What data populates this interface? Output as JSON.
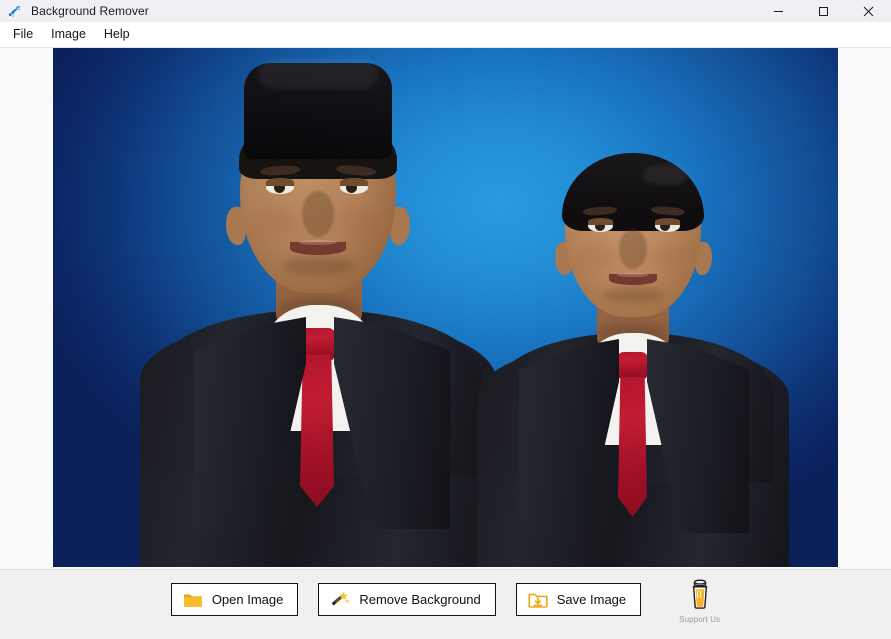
{
  "window": {
    "title": "Background Remover",
    "icon": "app-brush-icon",
    "controls": {
      "minimize": "minimize-icon",
      "maximize": "maximize-icon",
      "close": "close-icon"
    }
  },
  "menu": {
    "items": [
      {
        "label": "File"
      },
      {
        "label": "Image"
      },
      {
        "label": "Help"
      }
    ]
  },
  "canvas": {
    "image_description": "Studio portrait of two men in dark suits, white shirts and red ties on a blue gradient backdrop; the left man wears a black peci cap",
    "background_gradient": {
      "center": "#2a9ae0",
      "edge": "#0a1f57"
    },
    "subject_colors": {
      "suit": "#1a1c23",
      "shirt": "#f4f3ef",
      "tie": "#b3142c",
      "skin": "#b07f57",
      "cap": "#0d0c10"
    }
  },
  "toolbar": {
    "buttons": [
      {
        "label": "Open Image",
        "icon": "folder-open-icon"
      },
      {
        "label": "Remove Background",
        "icon": "magic-wand-icon"
      },
      {
        "label": "Save Image",
        "icon": "folder-save-icon"
      }
    ],
    "support": {
      "label": "Support Us",
      "icon": "coffee-cup-icon"
    },
    "accent_color": "#f5b223"
  }
}
